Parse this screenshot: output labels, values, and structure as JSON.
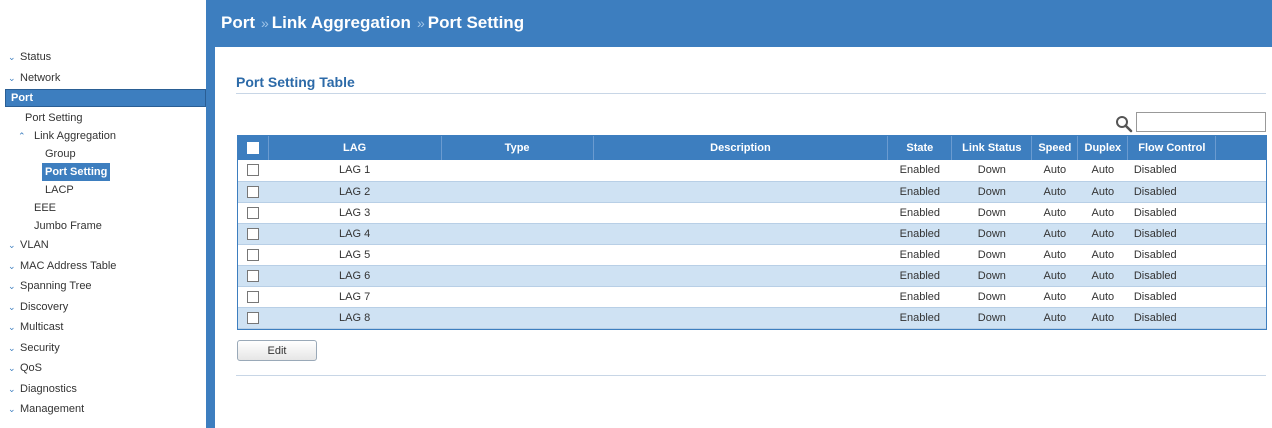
{
  "header": {
    "breadcrumb": [
      "Port",
      "Link Aggregation",
      "Port Setting"
    ],
    "separator": "»"
  },
  "sidebar": {
    "items": [
      {
        "label": "Status"
      },
      {
        "label": "Network"
      },
      {
        "label": "Port"
      },
      {
        "label": "Port Setting"
      },
      {
        "label": "Link Aggregation"
      },
      {
        "label": "Group"
      },
      {
        "label": "Port Setting"
      },
      {
        "label": "LACP"
      },
      {
        "label": "EEE"
      },
      {
        "label": "Jumbo Frame"
      },
      {
        "label": "VLAN"
      },
      {
        "label": "MAC Address Table"
      },
      {
        "label": "Spanning Tree"
      },
      {
        "label": "Discovery"
      },
      {
        "label": "Multicast"
      },
      {
        "label": "Security"
      },
      {
        "label": "QoS"
      },
      {
        "label": "Diagnostics"
      },
      {
        "label": "Management"
      }
    ]
  },
  "main": {
    "section_title": "Port Setting Table",
    "search": {
      "value": "",
      "placeholder": ""
    },
    "table": {
      "columns": [
        "LAG",
        "Type",
        "Description",
        "State",
        "Link Status",
        "Speed",
        "Duplex",
        "Flow Control"
      ],
      "rows": [
        {
          "lag": "LAG 1",
          "type": "",
          "description": "",
          "state": "Enabled",
          "link_status": "Down",
          "speed": "Auto",
          "duplex": "Auto",
          "flow_control": "Disabled"
        },
        {
          "lag": "LAG 2",
          "type": "",
          "description": "",
          "state": "Enabled",
          "link_status": "Down",
          "speed": "Auto",
          "duplex": "Auto",
          "flow_control": "Disabled"
        },
        {
          "lag": "LAG 3",
          "type": "",
          "description": "",
          "state": "Enabled",
          "link_status": "Down",
          "speed": "Auto",
          "duplex": "Auto",
          "flow_control": "Disabled"
        },
        {
          "lag": "LAG 4",
          "type": "",
          "description": "",
          "state": "Enabled",
          "link_status": "Down",
          "speed": "Auto",
          "duplex": "Auto",
          "flow_control": "Disabled"
        },
        {
          "lag": "LAG 5",
          "type": "",
          "description": "",
          "state": "Enabled",
          "link_status": "Down",
          "speed": "Auto",
          "duplex": "Auto",
          "flow_control": "Disabled"
        },
        {
          "lag": "LAG 6",
          "type": "",
          "description": "",
          "state": "Enabled",
          "link_status": "Down",
          "speed": "Auto",
          "duplex": "Auto",
          "flow_control": "Disabled"
        },
        {
          "lag": "LAG 7",
          "type": "",
          "description": "",
          "state": "Enabled",
          "link_status": "Down",
          "speed": "Auto",
          "duplex": "Auto",
          "flow_control": "Disabled"
        },
        {
          "lag": "LAG 8",
          "type": "",
          "description": "",
          "state": "Enabled",
          "link_status": "Down",
          "speed": "Auto",
          "duplex": "Auto",
          "flow_control": "Disabled"
        }
      ]
    },
    "edit_label": "Edit"
  },
  "colors": {
    "accent": "#3d7ebf",
    "row_alt": "#cfe2f3",
    "title": "#2c6aa8"
  },
  "icons": {
    "search": "search-icon",
    "expand": "chevron-down-icon",
    "collapse": "chevron-up-icon"
  }
}
